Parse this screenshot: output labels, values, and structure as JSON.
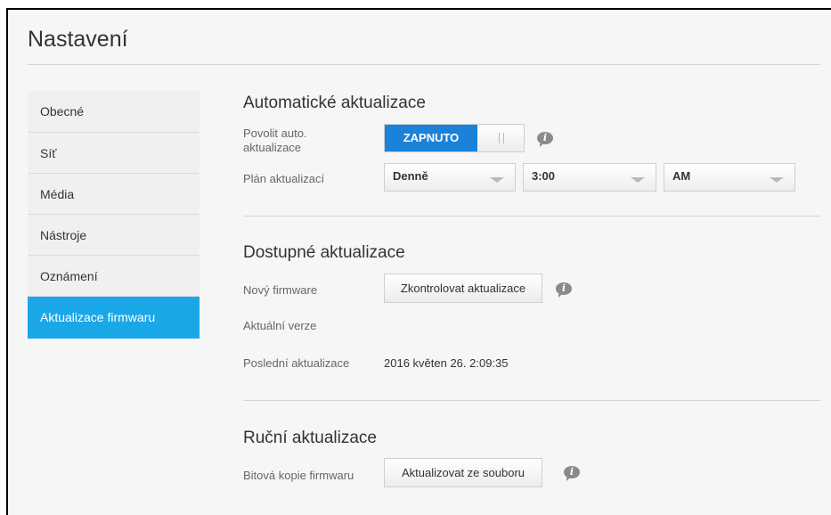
{
  "page": {
    "title": "Nastavení"
  },
  "sidebar": {
    "items": [
      {
        "label": "Obecné"
      },
      {
        "label": "Síť"
      },
      {
        "label": "Média"
      },
      {
        "label": "Nástroje"
      },
      {
        "label": "Oznámení"
      },
      {
        "label": "Aktualizace firmwaru",
        "active": true
      }
    ]
  },
  "auto_updates": {
    "title": "Automatické aktualizace",
    "enable_label": "Povolit auto. aktualizace",
    "toggle_state": "ZAPNUTO",
    "schedule_label": "Plán aktualizací",
    "frequency": "Denně",
    "time": "3:00",
    "period": "AM"
  },
  "available_updates": {
    "title": "Dostupné aktualizace",
    "new_firmware_label": "Nový firmware",
    "check_button": "Zkontrolovat aktualizace",
    "current_version_label": "Aktuální verze",
    "last_update_label": "Poslední aktualizace",
    "last_update_value": "2016 květen 26. 2:09:35"
  },
  "manual_update": {
    "title": "Ruční aktualizace",
    "image_label": "Bitová kopie firmwaru",
    "file_button": "Aktualizovat ze souboru"
  },
  "colors": {
    "accent": "#1aa7e8",
    "toggle_on": "#1a82d9",
    "background": "#f6f6f6"
  },
  "icons": {
    "info": "info-icon"
  }
}
